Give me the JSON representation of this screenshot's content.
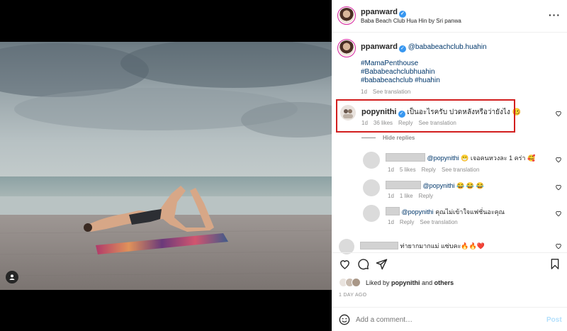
{
  "post": {
    "author": "ppanward",
    "location": "Baba Beach Club Hua Hin by Sri panwa"
  },
  "caption": {
    "author": "ppanward",
    "mention": "@bababeachclub.huahin",
    "hashtags": [
      "#MamaPenthouse",
      "#Bababeachclubhuahin",
      "#bababeachclub #huahin"
    ],
    "time": "1d",
    "see_translation": "See translation"
  },
  "highlighted_comment": {
    "author": "popynithi",
    "text": "เป็นอะไรครับ ปวดหลังหรือว่ายังไง 🥴",
    "time": "1d",
    "likes": "36 likes",
    "reply": "Reply",
    "see_translation": "See translation"
  },
  "hide_replies": "Hide replies",
  "replies": [
    {
      "mention": "@popynithi",
      "text": "😁 เจอคนหวงละ 1 คร่า 🥰",
      "time": "1d",
      "likes": "5 likes",
      "reply": "Reply",
      "see_translation": "See translation"
    },
    {
      "mention": "@popynithi",
      "text": "😂 😂 😂",
      "time": "1d",
      "likes": "1 like",
      "reply": "Reply"
    },
    {
      "mention": "@popynithi",
      "text": "คุณไม่เข้าใจแฟชั่นอะคุณ",
      "time": "1d",
      "likes": "",
      "reply": "Reply",
      "see_translation": "See translation"
    }
  ],
  "next_comment": {
    "text": "ท่ายากมากแม่ แซ่บคะ🔥🔥❤️"
  },
  "liked_by": {
    "prefix": "Liked by",
    "user": "popynithi",
    "and": "and",
    "others": "others"
  },
  "date": "1 DAY AGO",
  "composer": {
    "placeholder": "Add a comment…",
    "post": "Post"
  },
  "icons": {
    "verified": "verified-badge-icon",
    "more": "more-options-icon",
    "heart": "heart-icon",
    "comment": "comment-icon",
    "share": "share-icon",
    "save": "bookmark-icon",
    "emoji": "emoji-icon",
    "tag": "user-tag-icon"
  },
  "colors": {
    "link": "#00376b",
    "verified": "#3897f0",
    "highlight": "#d21e1e",
    "post_button": "#b2dffc"
  }
}
